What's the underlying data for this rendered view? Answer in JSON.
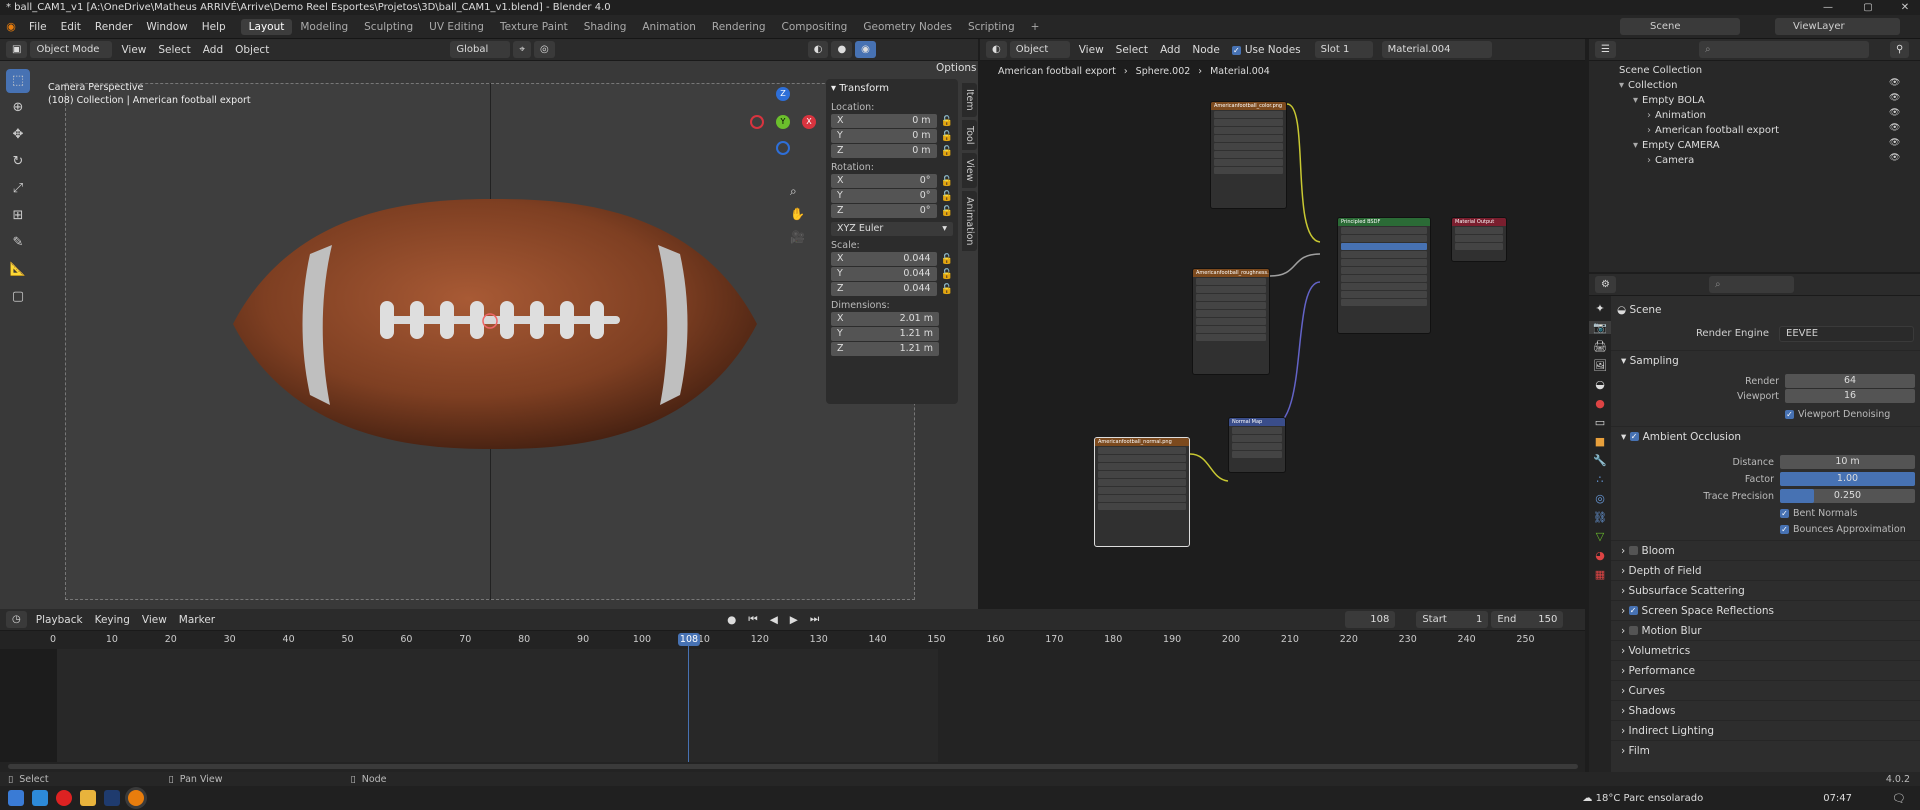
{
  "titlebar": {
    "text": "* ball_CAM1_v1 [A:\\OneDrive\\Matheus ARRIVÉ\\Arrive\\Demo Reel Esportes\\Projetos\\3D\\ball_CAM1_v1.blend] - Blender 4.0"
  },
  "menu": {
    "items": [
      "File",
      "Edit",
      "Render",
      "Window",
      "Help"
    ]
  },
  "workspaces": [
    "Layout",
    "Modeling",
    "Sculpting",
    "UV Editing",
    "Texture Paint",
    "Shading",
    "Animation",
    "Rendering",
    "Compositing",
    "Geometry Nodes",
    "Scripting"
  ],
  "scene": {
    "name": "Scene",
    "viewlayer": "ViewLayer"
  },
  "viewport": {
    "mode": "Object Mode",
    "menus": [
      "View",
      "Select",
      "Add",
      "Object"
    ],
    "orientation": "Global",
    "options": "Options",
    "overlay_title": "Camera Perspective",
    "overlay_sub": "(108) Collection | American football export",
    "gizmo": {
      "x": "X",
      "y": "Y",
      "z": "Z"
    }
  },
  "npanel": {
    "title": "Transform",
    "location_label": "Location:",
    "loc": [
      {
        "k": "X",
        "v": "0 m"
      },
      {
        "k": "Y",
        "v": "0 m"
      },
      {
        "k": "Z",
        "v": "0 m"
      }
    ],
    "rotation_label": "Rotation:",
    "rot": [
      {
        "k": "X",
        "v": "0°"
      },
      {
        "k": "Y",
        "v": "0°"
      },
      {
        "k": "Z",
        "v": "0°"
      }
    ],
    "rot_mode": "XYZ Euler",
    "scale_label": "Scale:",
    "scale": [
      {
        "k": "X",
        "v": "0.044"
      },
      {
        "k": "Y",
        "v": "0.044"
      },
      {
        "k": "Z",
        "v": "0.044"
      }
    ],
    "dim_label": "Dimensions:",
    "dim": [
      {
        "k": "X",
        "v": "2.01 m"
      },
      {
        "k": "Y",
        "v": "1.21 m"
      },
      {
        "k": "Z",
        "v": "1.21 m"
      }
    ],
    "tabs": [
      "Item",
      "Tool",
      "View",
      "Animation"
    ]
  },
  "nodeeditor": {
    "object": "Object",
    "menus": [
      "View",
      "Select",
      "Add",
      "Node"
    ],
    "use_nodes": "Use Nodes",
    "slot": "Slot 1",
    "material": "Material.004",
    "breadcrumb": [
      "American football export",
      "Sphere.002",
      "Material.004"
    ],
    "nodes": {
      "color": "Americanfootball_color.png",
      "rough": "Americanfootball_roughness.png",
      "normal": "Americanfootball_normal.png",
      "bsdf": "Principled BSDF",
      "output": "Material Output",
      "normalmap": "Normal Map"
    }
  },
  "timeline": {
    "menus": [
      "Playback",
      "Keying",
      "View",
      "Marker"
    ],
    "current": "108",
    "start_label": "Start",
    "start": "1",
    "end_label": "End",
    "end": "150",
    "ticks": [
      "0",
      "10",
      "20",
      "30",
      "40",
      "50",
      "60",
      "70",
      "80",
      "90",
      "100",
      "110",
      "120",
      "130",
      "140",
      "150",
      "160",
      "170",
      "180",
      "190",
      "200",
      "210",
      "220",
      "230",
      "240",
      "250"
    ]
  },
  "outliner": {
    "root": "Scene Collection",
    "items": [
      {
        "label": "Collection",
        "depth": 0
      },
      {
        "label": "Empty BOLA",
        "depth": 1
      },
      {
        "label": "Animation",
        "depth": 2
      },
      {
        "label": "American football export",
        "depth": 2
      },
      {
        "label": "Empty CAMERA",
        "depth": 1
      },
      {
        "label": "Camera",
        "depth": 2
      }
    ]
  },
  "properties": {
    "scene": "Scene",
    "engine_label": "Render Engine",
    "engine": "EEVEE",
    "sampling": "Sampling",
    "render_label": "Render",
    "render": "64",
    "viewport_label": "Viewport",
    "viewport": "16",
    "denoise": "Viewport Denoising",
    "ao": "Ambient Occlusion",
    "distance_label": "Distance",
    "distance": "10 m",
    "factor_label": "Factor",
    "factor": "1.00",
    "factor_fill": 1.0,
    "trace_label": "Trace Precision",
    "trace": "0.250",
    "trace_fill": 0.25,
    "bent": "Bent Normals",
    "bounces": "Bounces Approximation",
    "sections": [
      "Bloom",
      "Depth of Field",
      "Subsurface Scattering",
      "Screen Space Reflections",
      "Motion Blur",
      "Volumetrics",
      "Performance",
      "Curves",
      "Shadows",
      "Indirect Lighting",
      "Film"
    ]
  },
  "status": {
    "select": "Select",
    "pan": "Pan View",
    "node": "Node",
    "version": "4.0.2"
  },
  "taskbar": {
    "weather": "18°C Parc ensolarado",
    "time": "07:47"
  },
  "colors": {
    "accent": "#4772b3",
    "header": "#2b2b2b",
    "ball": "#8b4a2b",
    "frame": "#4772b3"
  }
}
